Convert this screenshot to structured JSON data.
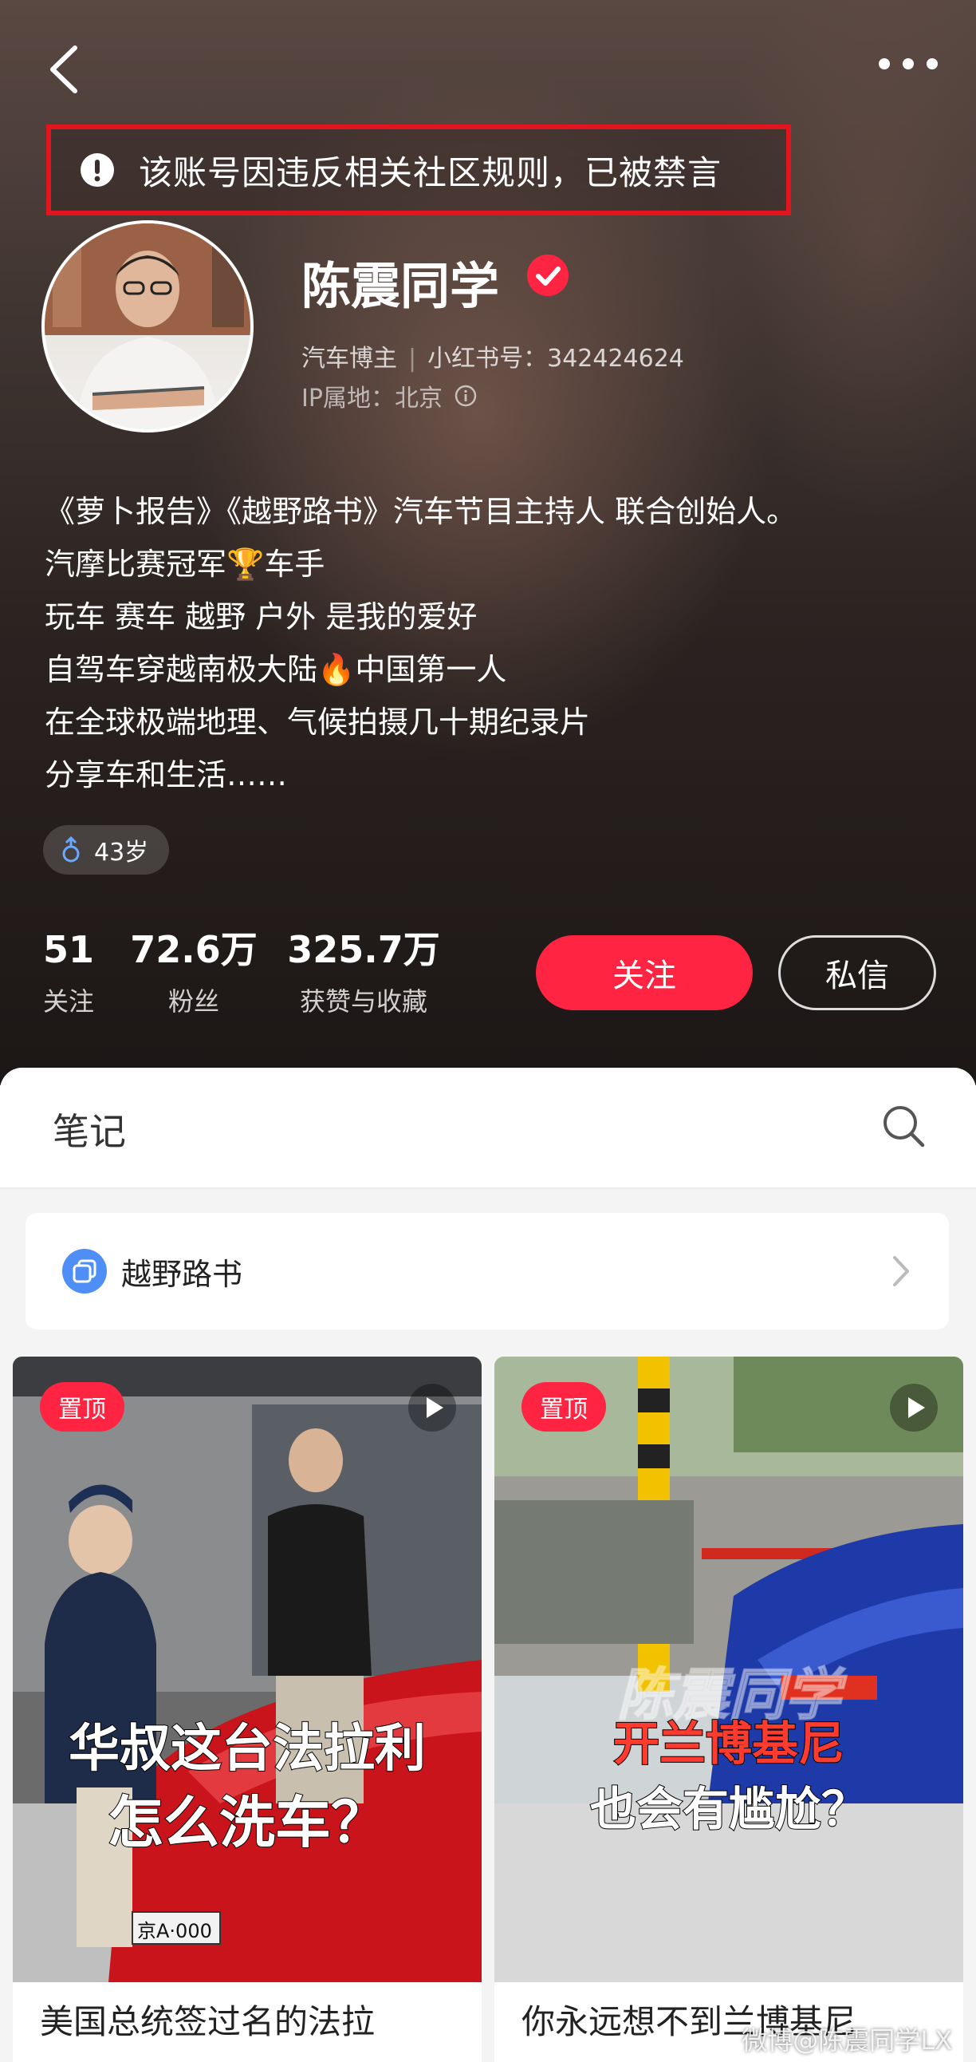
{
  "notice": "该账号因违反相关社区规则，已被禁言",
  "profile": {
    "nickname": "陈震同学",
    "category": "汽车博主",
    "id_label": "小红书号：342424624",
    "ip_label": "IP属地：北京",
    "bio": [
      "《萝卜报告》《越野路书》汽车节目主持人 联合创始人。",
      "汽摩比赛冠军🏆车手",
      "玩车 赛车 越野 户外 是我的爱好",
      "自驾车穿越南极大陆🔥中国第一人",
      "在全球极端地理、气候拍摄几十期纪录片",
      "分享车和生活……"
    ],
    "age": "43岁"
  },
  "stats": [
    {
      "value": "51",
      "label": "关注"
    },
    {
      "value": "72.6万",
      "label": "粉丝"
    },
    {
      "value": "325.7万",
      "label": "获赞与收藏"
    }
  ],
  "buttons": {
    "follow": "关注",
    "message": "私信"
  },
  "tabs": {
    "notes": "笔记"
  },
  "collection": {
    "label": "越野路书"
  },
  "notes": [
    {
      "badge": "置顶",
      "cover_line1": "华叔这台法拉利",
      "cover_line2": "怎么洗车？",
      "plate": "京A·000",
      "title": "美国总统签过名的法拉"
    },
    {
      "badge": "置顶",
      "cover_brand": "陈震同学",
      "cover_line1": "开兰博基尼",
      "cover_line2": "也会有尴尬？",
      "title": "你永远想不到兰博基尼"
    }
  ],
  "watermark": "微博@陈震同学LX",
  "colors": {
    "accent": "#ff2442",
    "notice_border": "#e4141f",
    "verified": "#ff2442",
    "collection_icon": "#4f8ef7"
  }
}
